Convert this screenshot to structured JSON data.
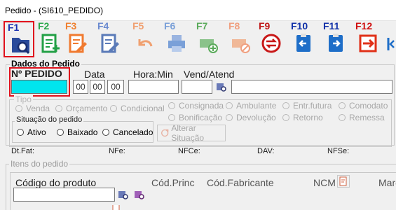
{
  "window": {
    "title": "Pedido - (SI610_PEDIDO)"
  },
  "toolbar": {
    "buttons": [
      {
        "key": "F1",
        "key_color": "#1a2fb0",
        "icon": "search-document-icon"
      },
      {
        "key": "F2",
        "key_color": "#2aa84a",
        "icon": "add-document-icon"
      },
      {
        "key": "F3",
        "key_color": "#f08030",
        "icon": "edit-document-icon"
      },
      {
        "key": "F4",
        "key_color": "#6a8ad0",
        "icon": "edit-document-blue-icon"
      },
      {
        "key": "F5",
        "key_color": "#f0a070",
        "icon": "undo-icon"
      },
      {
        "key": "F6",
        "key_color": "#7aa0d8",
        "icon": "printer-icon"
      },
      {
        "key": "F7",
        "key_color": "#5aaa5a",
        "icon": "money-add-icon"
      },
      {
        "key": "F8",
        "key_color": "#f0a080",
        "icon": "money-cancel-icon"
      },
      {
        "key": "F9",
        "key_color": "#c01818",
        "icon": "exchange-icon"
      },
      {
        "key": "F10",
        "key_color": "#1030a8",
        "icon": "clipboard-left-icon"
      },
      {
        "key": "F11",
        "key_color": "#1030a8",
        "icon": "clipboard-right-icon"
      },
      {
        "key": "F12",
        "key_color": "#d01010",
        "icon": "exit-icon"
      }
    ]
  },
  "dados": {
    "legend": "Dados do Pedido",
    "nr_label": "Nº PEDIDO",
    "data_label": "Data",
    "hora_label": "Hora:Min",
    "vend_label": "Vend/Atend",
    "day": "00",
    "month": "00",
    "year": "00"
  },
  "tipo": {
    "legend": "Tipo",
    "options": [
      "Venda",
      "Orçamento",
      "Condicional",
      "Consignada",
      "Bonificação",
      "Ambulante",
      "Devolução",
      "Entr.futura",
      "Retorno",
      "Comodato",
      "Remessa"
    ]
  },
  "situacao": {
    "legend": "Situação do pedido",
    "options": [
      "Ativo",
      "Baixado",
      "Cancelado"
    ],
    "alterar_label": "Alterar Situação"
  },
  "info": {
    "dtfat": "Dt.Fat:",
    "nfe": "NFe:",
    "nfce": "NFCe:",
    "dav": "DAV:",
    "nfse": "NFSe:"
  },
  "itens": {
    "legend": "Itens do pedido",
    "codigo_label": "Código do produto",
    "cod_princ_label": "Cód.Princ",
    "cod_fab_label": "Cód.Fabricante",
    "ncm_label": "NCM",
    "marca_label": "Marc"
  },
  "colors": {
    "highlight": "#e0101c",
    "cyan_field": "#00e5ee"
  }
}
